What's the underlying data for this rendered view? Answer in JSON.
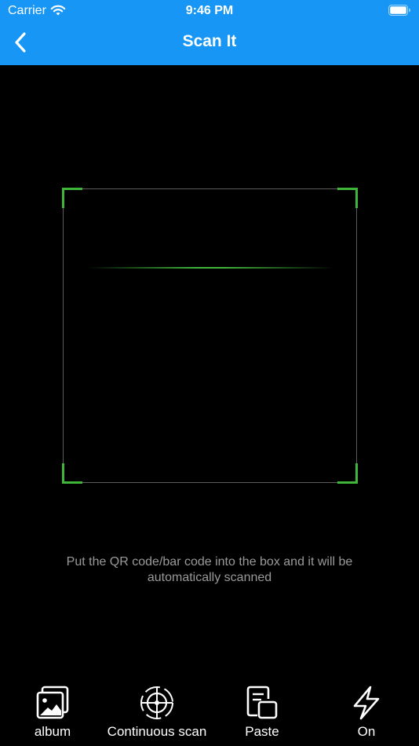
{
  "status_bar": {
    "carrier": "Carrier",
    "time": "9:46 PM"
  },
  "nav": {
    "title": "Scan It"
  },
  "scanner": {
    "hint": "Put the QR code/bar code into the box and it will be automatically scanned"
  },
  "toolbar": {
    "album": "album",
    "continuous": "Continuous scan",
    "paste": "Paste",
    "flash": "On"
  },
  "colors": {
    "header": "#1796f6",
    "accent": "#3fb63a",
    "background": "#000000",
    "hint": "#9a9a9a"
  },
  "icons": [
    "wifi-icon",
    "battery-icon",
    "back-chevron-icon",
    "album-icon",
    "continuous-scan-icon",
    "paste-icon",
    "flash-icon"
  ]
}
